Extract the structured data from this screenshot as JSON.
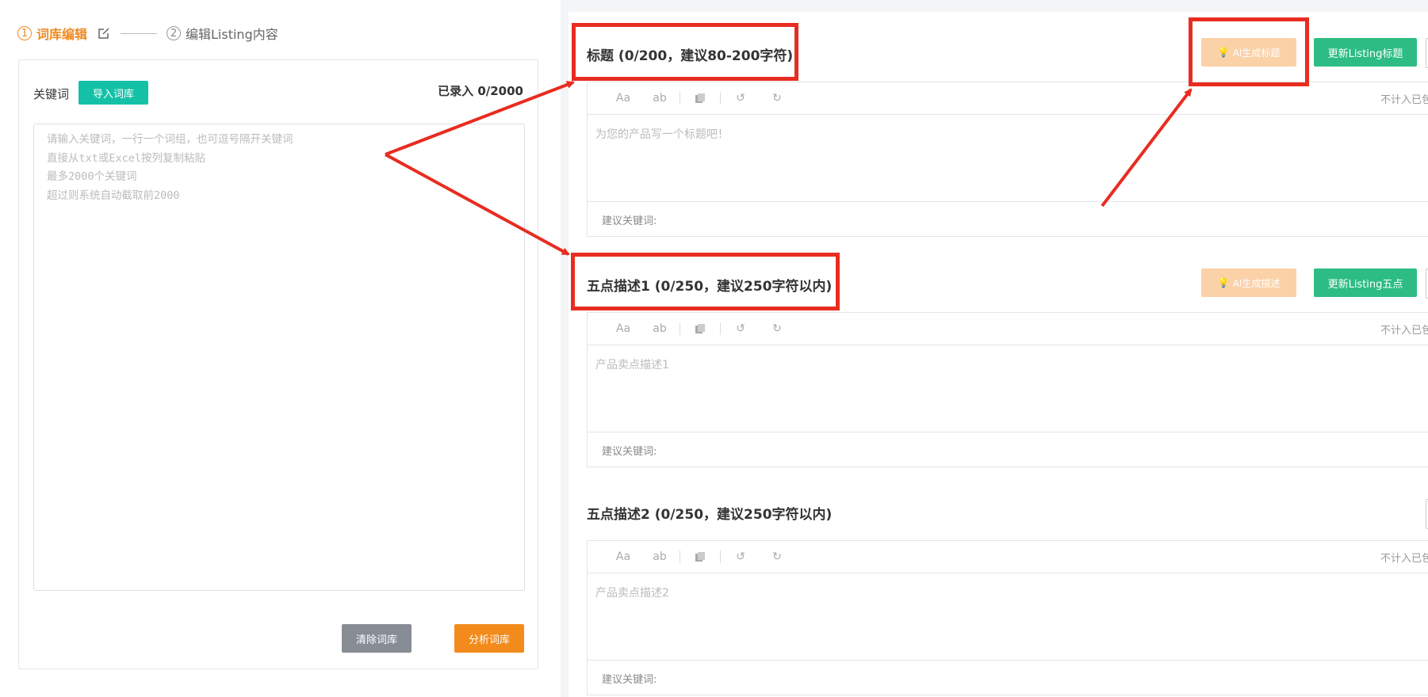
{
  "steps": [
    {
      "num": "1",
      "label": "词库编辑"
    },
    {
      "num": "2",
      "label": "编辑Listing内容"
    }
  ],
  "keyword_panel": {
    "label": "关键词",
    "import_button": "导入词库",
    "count_text": "已录入 0/2000",
    "placeholder_lines": [
      "请输入关键词，一行一个词组，也可逗号隔开关键词",
      "直接从txt或Excel按列复制粘贴",
      "最多2000个关键词",
      "超过则系统自动截取前2000"
    ],
    "clear_button": "清除词库",
    "analyze_button": "分析词库"
  },
  "fields": [
    {
      "title": "标题 (0/200，建议80-200字符)",
      "ai_button": "AI生成标题",
      "update_button": "更新Listing标题",
      "placeholder": "为您的产品写一个标题吧！",
      "toolbar_right": "不计入已包",
      "suggest_label": "建议关键词:"
    },
    {
      "title": "五点描述1 (0/250，建议250字符以内)",
      "ai_button": "AI生成描述",
      "update_button": "更新Listing五点",
      "placeholder": "产品卖点描述1",
      "toolbar_right": "不计入已包",
      "suggest_label": "建议关键词:"
    },
    {
      "title": "五点描述2 (0/250，建议250字符以内)",
      "placeholder": "产品卖点描述2",
      "toolbar_right": "不计入已包",
      "suggest_label": "建议关键词:"
    }
  ],
  "toolbar": {
    "font_size": "Aa",
    "case": "ab"
  },
  "colors": {
    "accent_orange": "#f08a24",
    "teal": "#14c1a6",
    "green": "#2dbd84",
    "annotation_red": "#e82c20"
  }
}
